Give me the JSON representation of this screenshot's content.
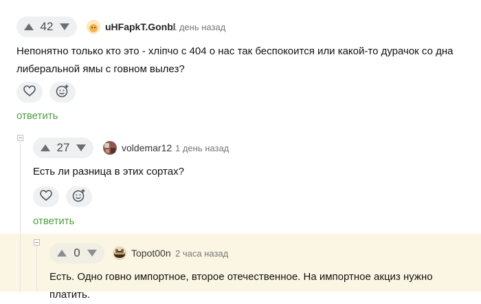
{
  "comments": [
    {
      "votes": "42",
      "username": "uHFapkT.Gonbl",
      "time": "1 день назад",
      "text": "Непонятно только кто это - хлiпчо с 404 о нас так беспокоится или какой-то дурачок со дна либеральной ямы с говном вылез?",
      "reply_label": "ответить"
    },
    {
      "votes": "27",
      "username": "voldemar12",
      "time": "1 день назад",
      "text": "Есть ли разница в этих сортах?",
      "reply_label": "ответить"
    },
    {
      "votes": "0",
      "username": "Topot00n",
      "time": "2 часа назад",
      "text": "Есть. Одно говно импортное, второе отечественное. На импортное акциз нужно платить."
    }
  ],
  "icons": {
    "upvote": "arrow-up-icon",
    "downvote": "arrow-down-icon",
    "like": "heart-icon",
    "react": "emoji-add-icon",
    "collapse": "collapse-toggle-icon"
  },
  "colors": {
    "reply_link": "#4c9e3f",
    "highlight_bg": "#fbf6e3",
    "pill_bg": "#eef0f2"
  }
}
